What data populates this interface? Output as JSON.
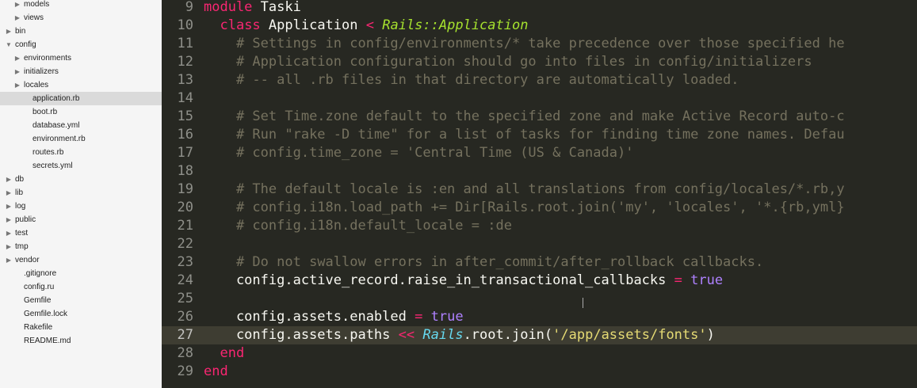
{
  "sidebar": {
    "items": [
      {
        "label": "models",
        "level": 3,
        "expandable": true,
        "expanded": false
      },
      {
        "label": "views",
        "level": 3,
        "expandable": true,
        "expanded": false
      },
      {
        "label": "bin",
        "level": 2,
        "expandable": true,
        "expanded": false
      },
      {
        "label": "config",
        "level": 2,
        "expandable": true,
        "expanded": true
      },
      {
        "label": "environments",
        "level": 3,
        "expandable": true,
        "expanded": false
      },
      {
        "label": "initializers",
        "level": 3,
        "expandable": true,
        "expanded": false
      },
      {
        "label": "locales",
        "level": 3,
        "expandable": true,
        "expanded": false
      },
      {
        "label": "application.rb",
        "level": 3,
        "expandable": false,
        "selected": true
      },
      {
        "label": "boot.rb",
        "level": 3,
        "expandable": false
      },
      {
        "label": "database.yml",
        "level": 3,
        "expandable": false
      },
      {
        "label": "environment.rb",
        "level": 3,
        "expandable": false
      },
      {
        "label": "routes.rb",
        "level": 3,
        "expandable": false
      },
      {
        "label": "secrets.yml",
        "level": 3,
        "expandable": false
      },
      {
        "label": "db",
        "level": 2,
        "expandable": true,
        "expanded": false
      },
      {
        "label": "lib",
        "level": 2,
        "expandable": true,
        "expanded": false
      },
      {
        "label": "log",
        "level": 2,
        "expandable": true,
        "expanded": false
      },
      {
        "label": "public",
        "level": 2,
        "expandable": true,
        "expanded": false
      },
      {
        "label": "test",
        "level": 2,
        "expandable": true,
        "expanded": false
      },
      {
        "label": "tmp",
        "level": 2,
        "expandable": true,
        "expanded": false
      },
      {
        "label": "vendor",
        "level": 2,
        "expandable": true,
        "expanded": false
      },
      {
        "label": ".gitignore",
        "level": 2,
        "expandable": false
      },
      {
        "label": "config.ru",
        "level": 2,
        "expandable": false
      },
      {
        "label": "Gemfile",
        "level": 2,
        "expandable": false
      },
      {
        "label": "Gemfile.lock",
        "level": 2,
        "expandable": false
      },
      {
        "label": "Rakefile",
        "level": 2,
        "expandable": false
      },
      {
        "label": "README.md",
        "level": 2,
        "expandable": false
      }
    ]
  },
  "editor": {
    "current_line": 27,
    "colors": {
      "background": "#272822",
      "keyword": "#f92672",
      "comment": "#75715e",
      "string": "#e6db74",
      "boolean": "#ae81ff",
      "class_name": "#a6e22e",
      "constant": "#66d9ef"
    },
    "lines": [
      {
        "n": "9",
        "tokens": [
          [
            "kw",
            "module"
          ],
          [
            "plain",
            " Taski"
          ]
        ]
      },
      {
        "n": "10",
        "tokens": [
          [
            "plain",
            "  "
          ],
          [
            "kw",
            "class"
          ],
          [
            "plain",
            " Application "
          ],
          [
            "op",
            "<"
          ],
          [
            "plain",
            " "
          ],
          [
            "inh",
            "Rails::Application"
          ]
        ]
      },
      {
        "n": "11",
        "tokens": [
          [
            "plain",
            "    "
          ],
          [
            "cm",
            "# Settings in config/environments/* take precedence over those specified he"
          ]
        ]
      },
      {
        "n": "12",
        "tokens": [
          [
            "plain",
            "    "
          ],
          [
            "cm",
            "# Application configuration should go into files in config/initializers"
          ]
        ]
      },
      {
        "n": "13",
        "tokens": [
          [
            "plain",
            "    "
          ],
          [
            "cm",
            "# -- all .rb files in that directory are automatically loaded."
          ]
        ]
      },
      {
        "n": "14",
        "tokens": []
      },
      {
        "n": "15",
        "tokens": [
          [
            "plain",
            "    "
          ],
          [
            "cm",
            "# Set Time.zone default to the specified zone and make Active Record auto-c"
          ]
        ]
      },
      {
        "n": "16",
        "tokens": [
          [
            "plain",
            "    "
          ],
          [
            "cm",
            "# Run \"rake -D time\" for a list of tasks for finding time zone names. Defau"
          ]
        ]
      },
      {
        "n": "17",
        "tokens": [
          [
            "plain",
            "    "
          ],
          [
            "cm",
            "# config.time_zone = 'Central Time (US & Canada)'"
          ]
        ]
      },
      {
        "n": "18",
        "tokens": []
      },
      {
        "n": "19",
        "tokens": [
          [
            "plain",
            "    "
          ],
          [
            "cm",
            "# The default locale is :en and all translations from config/locales/*.rb,y"
          ]
        ]
      },
      {
        "n": "20",
        "tokens": [
          [
            "plain",
            "    "
          ],
          [
            "cm",
            "# config.i18n.load_path += Dir[Rails.root.join('my', 'locales', '*.{rb,yml}"
          ]
        ]
      },
      {
        "n": "21",
        "tokens": [
          [
            "plain",
            "    "
          ],
          [
            "cm",
            "# config.i18n.default_locale = :de"
          ]
        ]
      },
      {
        "n": "22",
        "tokens": []
      },
      {
        "n": "23",
        "tokens": [
          [
            "plain",
            "    "
          ],
          [
            "cm",
            "# Do not swallow errors in after_commit/after_rollback callbacks."
          ]
        ]
      },
      {
        "n": "24",
        "tokens": [
          [
            "plain",
            "    config.active_record.raise_in_transactional_callbacks "
          ],
          [
            "op",
            "="
          ],
          [
            "plain",
            " "
          ],
          [
            "bool",
            "true"
          ]
        ]
      },
      {
        "n": "25",
        "tokens": []
      },
      {
        "n": "26",
        "tokens": [
          [
            "plain",
            "    config.assets.enabled "
          ],
          [
            "op",
            "="
          ],
          [
            "plain",
            " "
          ],
          [
            "bool",
            "true"
          ]
        ]
      },
      {
        "n": "27",
        "tokens": [
          [
            "plain",
            "    config.assets.paths "
          ],
          [
            "op",
            "<<"
          ],
          [
            "plain",
            " "
          ],
          [
            "cnst",
            "Rails"
          ],
          [
            "plain",
            ".root.join("
          ],
          [
            "str",
            "'/app/assets/fonts'"
          ],
          [
            "plain",
            ")"
          ]
        ]
      },
      {
        "n": "28",
        "tokens": [
          [
            "plain",
            "  "
          ],
          [
            "kw",
            "end"
          ]
        ]
      },
      {
        "n": "29",
        "tokens": [
          [
            "kw",
            "end"
          ]
        ]
      }
    ]
  }
}
